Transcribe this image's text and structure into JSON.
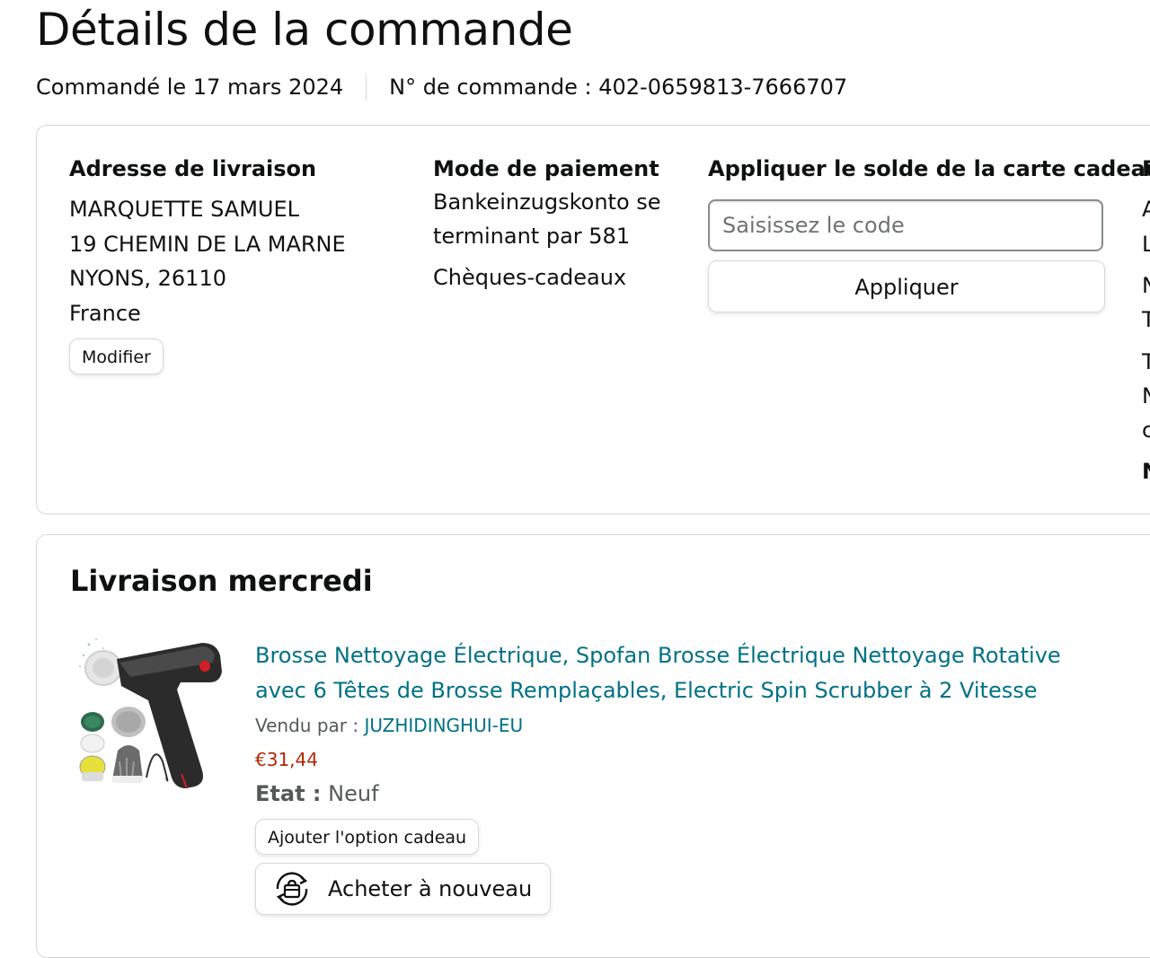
{
  "page": {
    "title": "Détails de la commande"
  },
  "order": {
    "ordered_on": "Commandé le 17 mars 2024",
    "order_number": "N° de commande : 402-0659813-7666707"
  },
  "shipping": {
    "heading": "Adresse de livraison",
    "name": "MARQUETTE SAMUEL",
    "street": "19 CHEMIN DE LA MARNE",
    "city": "NYONS, 26110",
    "country": "France",
    "edit_label": "Modifier"
  },
  "payment": {
    "heading": "Mode de paiement",
    "method": "Bankeinzugskonto se terminant par 581",
    "gift_cards": "Chèques-cadeaux"
  },
  "gift_card": {
    "heading": "Appliquer le solde de la carte cadeau",
    "placeholder": "Saisissez le code",
    "apply_label": "Appliquer"
  },
  "summary_cutoff": {
    "heading_fragment": "R",
    "line1": "A",
    "line2": "L",
    "line3": "N",
    "line4": "T",
    "line5": "T",
    "line6": "N",
    "line7": "c",
    "line8": "N"
  },
  "delivery": {
    "title": "Livraison mercredi",
    "product": {
      "title": "Brosse Nettoyage Électrique, Spofan Brosse Électrique Nettoyage Rotative avec 6 Têtes de Brosse Remplaçables, Electric Spin Scrubber à 2 Vitesse",
      "sold_by_label": "Vendu par :",
      "seller": "JUZHIDINGHUI-EU",
      "price": "€31,44",
      "condition_label": "Etat :",
      "condition_value": "Neuf",
      "gift_option_label": "Ajouter l'option cadeau",
      "buy_again_label": "Acheter à nouveau",
      "image_icon": "electric-spin-scrubber-image"
    }
  },
  "colors": {
    "link": "#007185",
    "price": "#b12704",
    "border": "#d5d9d9",
    "text": "#0f1111",
    "muted": "#565959"
  }
}
